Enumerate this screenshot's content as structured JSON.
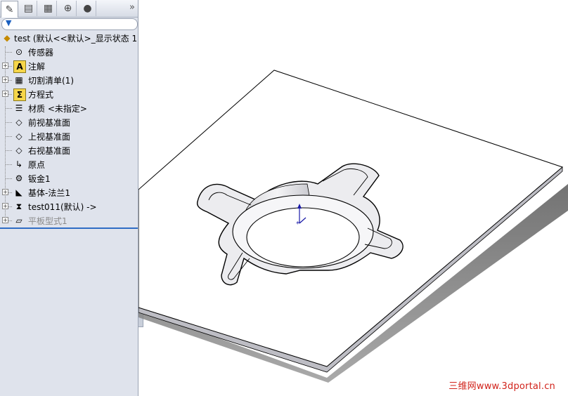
{
  "tabs": [
    {
      "icon": "feature-manager-icon",
      "glyph": "✎",
      "active": true
    },
    {
      "icon": "property-manager-icon",
      "glyph": "▤",
      "active": false
    },
    {
      "icon": "configuration-manager-icon",
      "glyph": "▦",
      "active": false
    },
    {
      "icon": "dimxpert-icon",
      "glyph": "⊕",
      "active": false
    },
    {
      "icon": "display-manager-icon",
      "glyph": "●",
      "active": false
    }
  ],
  "more_glyph": "»",
  "filter_glyph": "▼",
  "tree": {
    "root": {
      "label": "test  (默认<<默认>_显示状态 1",
      "icon": "part-icon"
    },
    "items": [
      {
        "label": "传感器",
        "icon": "sensor-icon",
        "glyph": "⊙",
        "expandable": false
      },
      {
        "label": "注解",
        "icon": "annotation-icon",
        "glyph": "A",
        "expandable": true
      },
      {
        "label": "切割清单(1)",
        "icon": "cut-list-icon",
        "glyph": "▦",
        "expandable": true
      },
      {
        "label": "方程式",
        "icon": "equation-icon",
        "glyph": "Σ",
        "expandable": true
      },
      {
        "label": "材质 <未指定>",
        "icon": "material-icon",
        "glyph": "☰",
        "expandable": false
      },
      {
        "label": "前视基准面",
        "icon": "plane-icon",
        "glyph": "◇",
        "expandable": false
      },
      {
        "label": "上视基准面",
        "icon": "plane-icon",
        "glyph": "◇",
        "expandable": false
      },
      {
        "label": "右视基准面",
        "icon": "plane-icon",
        "glyph": "◇",
        "expandable": false
      },
      {
        "label": "原点",
        "icon": "origin-icon",
        "glyph": "↳",
        "expandable": false
      },
      {
        "label": "钣金1",
        "icon": "sheet-metal-icon",
        "glyph": "⚙",
        "expandable": false
      },
      {
        "label": "基体-法兰1",
        "icon": "base-flange-icon",
        "glyph": "◣",
        "expandable": true
      },
      {
        "label": "test011(默认) ->",
        "icon": "derived-part-icon",
        "glyph": "⧗",
        "expandable": true
      },
      {
        "label": "平板型式1",
        "icon": "flat-pattern-icon",
        "glyph": "▱",
        "expandable": true,
        "suppressed": true
      }
    ]
  },
  "watermark": "三维网www.3dportal.cn",
  "colors": {
    "accent": "#2f6cc4",
    "panel": "#dfe3ec",
    "watermark": "#d1221a"
  }
}
